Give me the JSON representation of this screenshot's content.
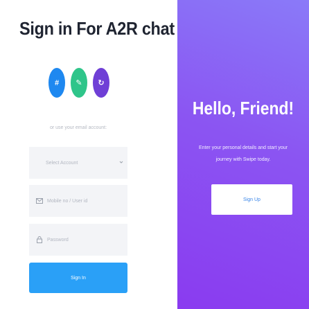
{
  "signin": {
    "title": "Sign in For A2R chat",
    "social": [
      {
        "icon": "hashtag-icon",
        "glyph": "#"
      },
      {
        "icon": "clipboard-icon",
        "glyph": "✎"
      },
      {
        "icon": "circular-arrow-icon",
        "glyph": "↻"
      }
    ],
    "hint": "or use your email account:",
    "select_placeholder": "Select Account",
    "mobile_placeholder": "Mobile no / User id",
    "password_placeholder": "Password",
    "signin_label": "Sign In"
  },
  "welcome": {
    "title": "Hello, Friend!",
    "line1": "Enter your personal details and start your",
    "line2": "journey with Swipe today.",
    "signup_label": "Sign Up"
  },
  "colors": {
    "accent_blue": "#2aa0f7",
    "panel_gradient_start": "#8a7af8",
    "panel_gradient_end": "#8a3bf0"
  }
}
